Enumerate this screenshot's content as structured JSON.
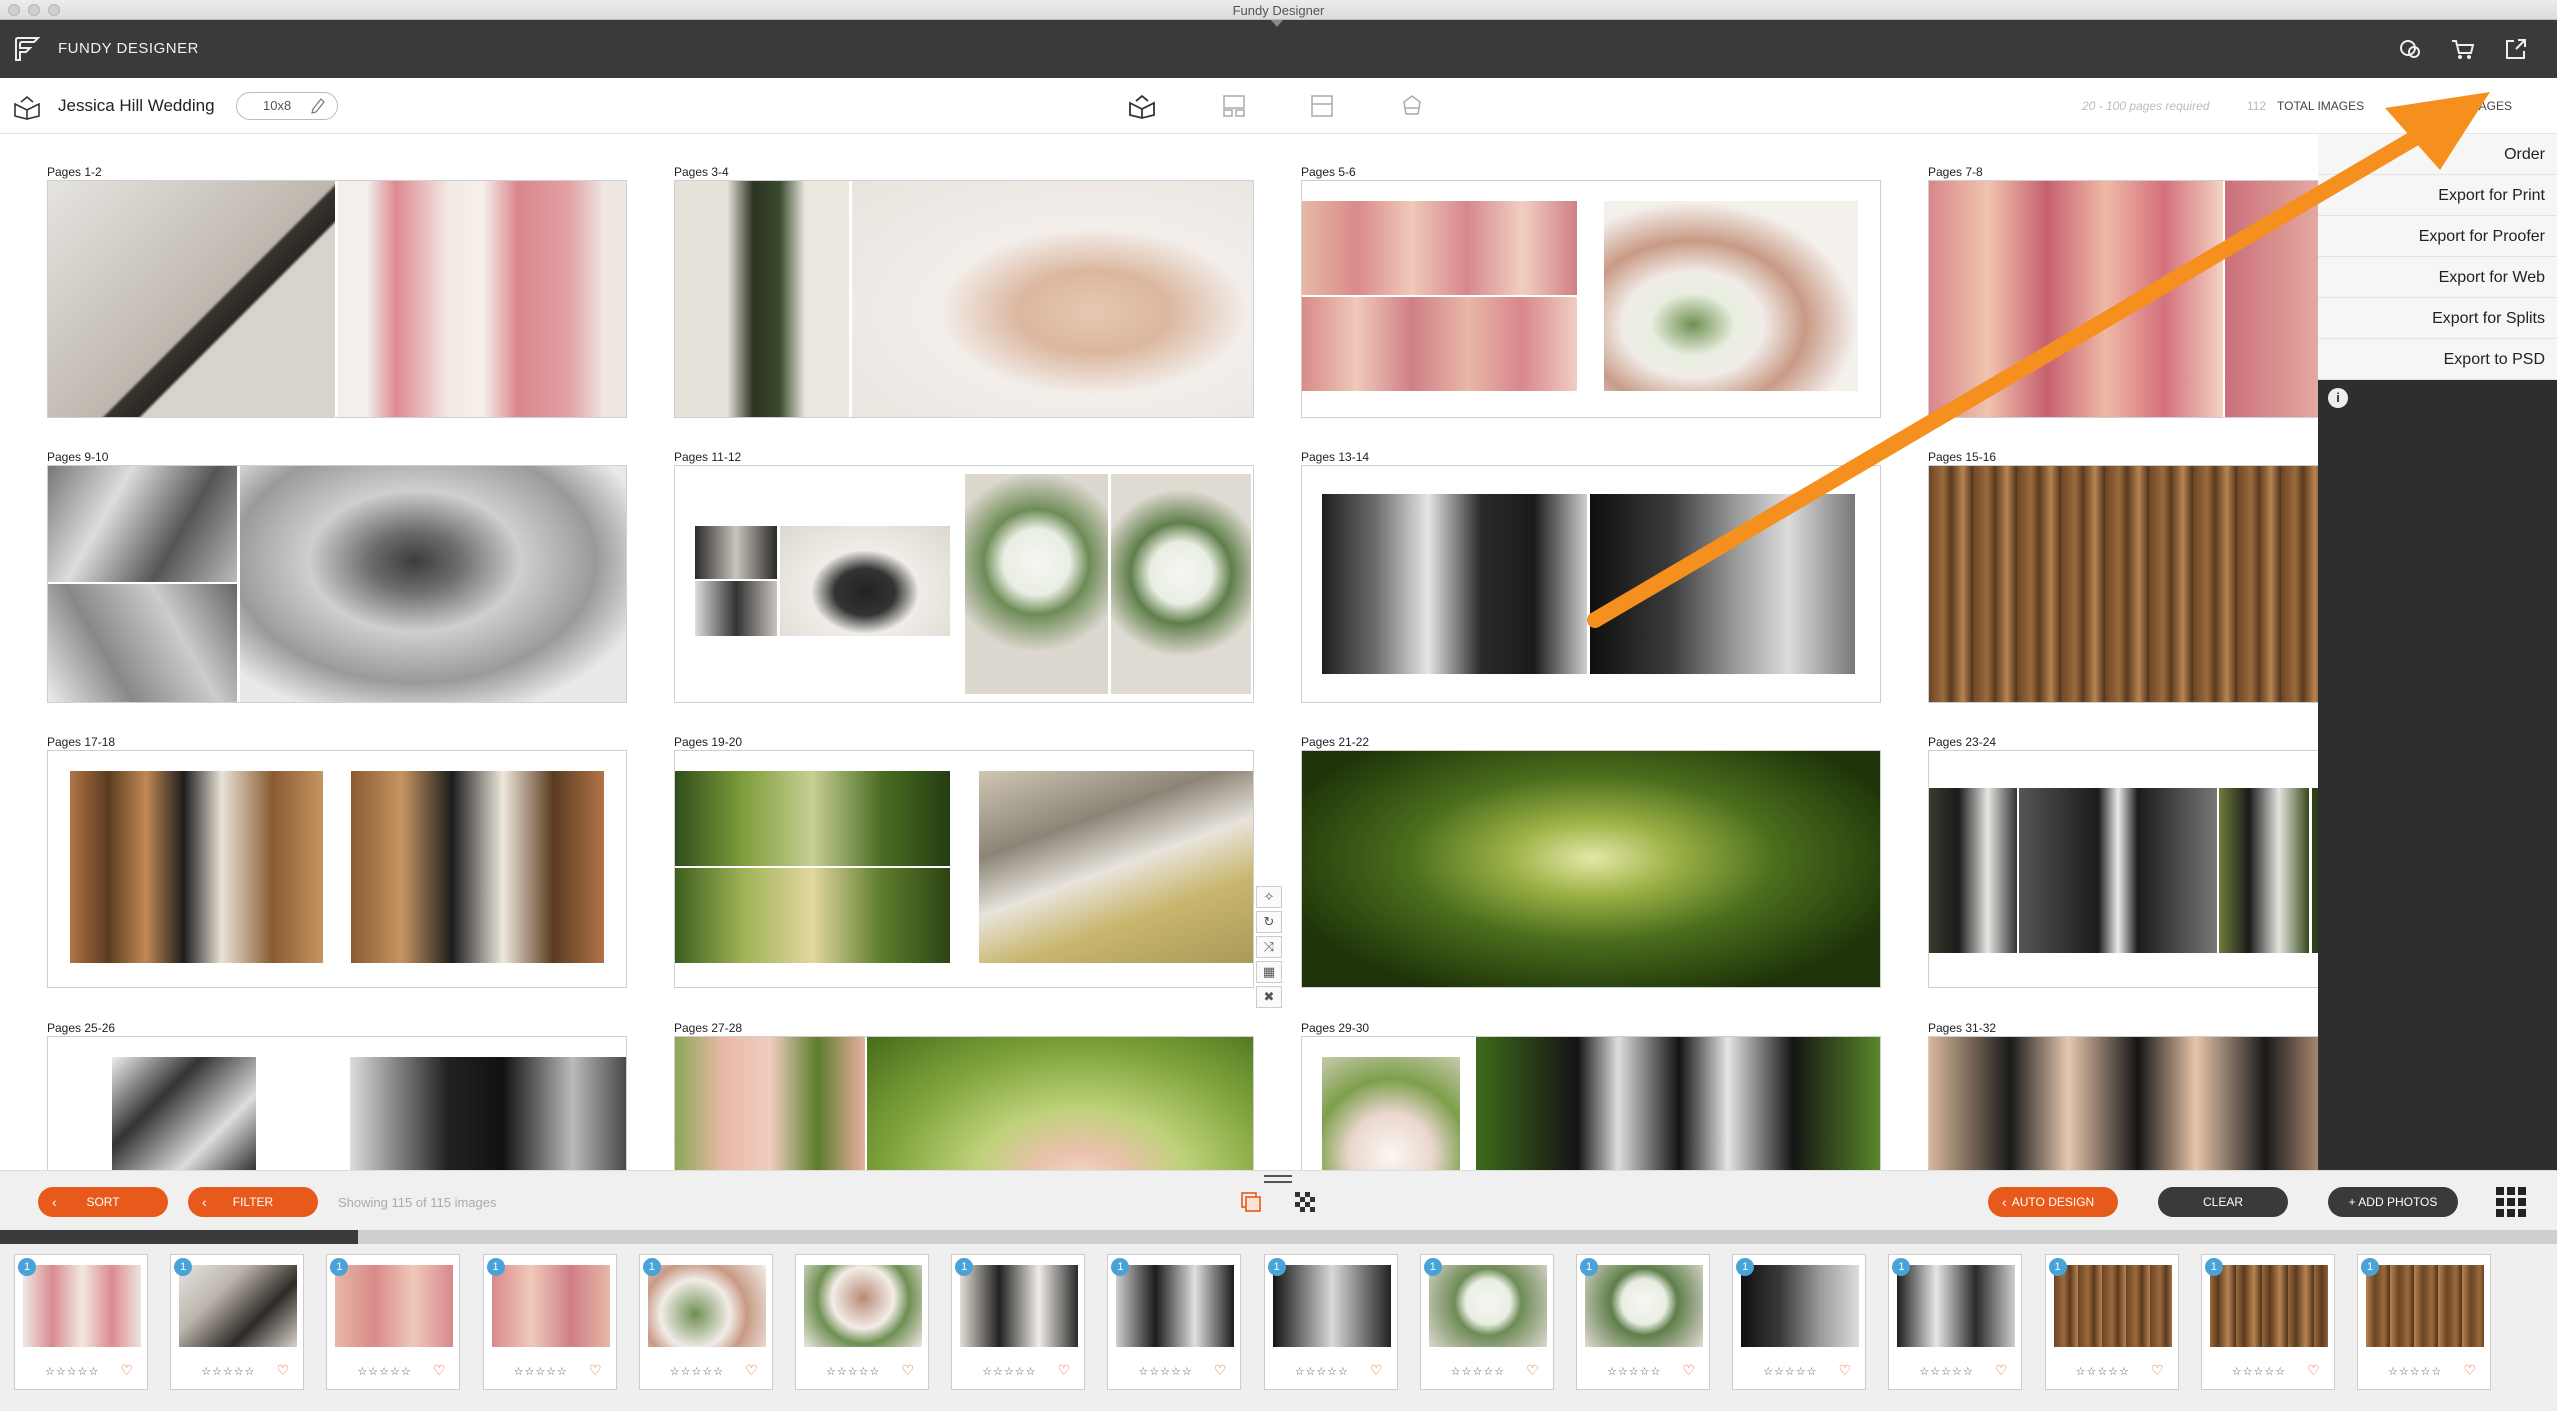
{
  "window": {
    "title": "Fundy Designer"
  },
  "appbar": {
    "app_name": "FUNDY DESIGNER"
  },
  "project": {
    "name": "Jessica Hill Wedding",
    "size": "10x8",
    "pages_required": "20 - 100 pages required",
    "image_count": "112",
    "images_label": "TOTAL IMAGES",
    "pages_label": "L PAGES"
  },
  "spreads": [
    {
      "label": "Pages 1-2"
    },
    {
      "label": "Pages 3-4"
    },
    {
      "label": "Pages 5-6"
    },
    {
      "label": "Pages 7-8"
    },
    {
      "label": "Pages 9-10"
    },
    {
      "label": "Pages 11-12"
    },
    {
      "label": "Pages 13-14"
    },
    {
      "label": "Pages 15-16"
    },
    {
      "label": "Pages 17-18"
    },
    {
      "label": "Pages 19-20"
    },
    {
      "label": "Pages 21-22"
    },
    {
      "label": "Pages 23-24"
    },
    {
      "label": "Pages 25-26"
    },
    {
      "label": "Pages 27-28"
    },
    {
      "label": "Pages 29-30"
    },
    {
      "label": "Pages 31-32"
    }
  ],
  "export_menu": {
    "items": [
      "Order",
      "Export for Print",
      "Export for Proofer",
      "Export for Web",
      "Export for Splits",
      "Export to PSD"
    ],
    "info": "i"
  },
  "spread_tools": [
    "✧",
    "↻",
    "⤨",
    "▦",
    "✖"
  ],
  "bottombar": {
    "sort": "SORT",
    "filter": "FILTER",
    "showing": "Showing 115 of 115 images",
    "auto_design": "AUTO DESIGN",
    "clear": "CLEAR",
    "add_photos": "+ ADD PHOTOS"
  },
  "progress": {
    "fraction": 0.14
  },
  "filmstrip": {
    "stars": "☆☆☆☆☆",
    "heart": "♡",
    "thumbs": [
      {
        "badge": "1"
      },
      {
        "badge": "1"
      },
      {
        "badge": "1"
      },
      {
        "badge": "1"
      },
      {
        "badge": "1"
      },
      {
        "badge": ""
      },
      {
        "badge": "1"
      },
      {
        "badge": "1"
      },
      {
        "badge": "1"
      },
      {
        "badge": "1"
      },
      {
        "badge": "1"
      },
      {
        "badge": "1"
      },
      {
        "badge": "1"
      },
      {
        "badge": "1"
      },
      {
        "badge": "1"
      },
      {
        "badge": "1"
      }
    ]
  },
  "colors": {
    "accent": "#e8591c",
    "dark": "#3a3a3a",
    "badge": "#4aa3d8",
    "arrow": "#f5901e"
  }
}
